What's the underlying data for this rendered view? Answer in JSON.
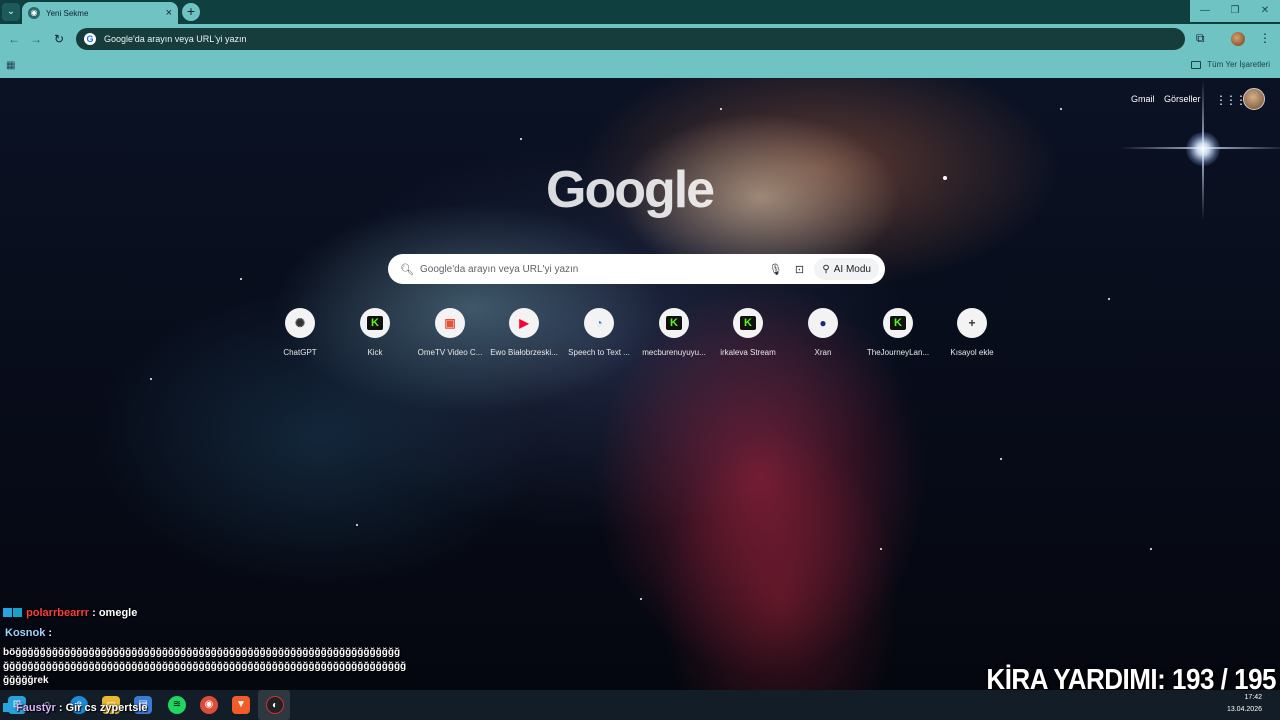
{
  "browser": {
    "tab_title": "Yeni Sekme",
    "omnibox_text": "Google'da arayın veya URL'yi yazın",
    "all_bookmarks": "Tüm Yer İşaretleri"
  },
  "ntp": {
    "gmail": "Gmail",
    "images": "Görseller",
    "logo": "Google",
    "search_placeholder": "Google'da arayın veya URL'yi yazın",
    "ai_mode": "AI Modu",
    "shortcuts": [
      {
        "label": "ChatGPT",
        "icon": "chatgpt-icon",
        "glyph": "✺",
        "color": "#333333"
      },
      {
        "label": "Kick",
        "icon": "kick-icon",
        "glyph": "K",
        "color": "#53fc18"
      },
      {
        "label": "OmeTV Video C...",
        "icon": "ometv-icon",
        "glyph": "▣",
        "color": "#e5533d"
      },
      {
        "label": "Ewo Białobrzeski...",
        "icon": "youtube-icon",
        "glyph": "▶",
        "color": "#ff0033"
      },
      {
        "label": "Speech to Text ...",
        "icon": "speech-icon",
        "glyph": "◔",
        "color": "#4a7bd0"
      },
      {
        "label": "mecburenuyuyu...",
        "icon": "kick-icon",
        "glyph": "K",
        "color": "#53fc18"
      },
      {
        "label": "irkaleva Stream",
        "icon": "kick-icon",
        "glyph": "K",
        "color": "#53fc18"
      },
      {
        "label": "Xran",
        "icon": "xran-icon",
        "glyph": "●",
        "color": "#1b2a7a"
      },
      {
        "label": "TheJourneyLan...",
        "icon": "kick-icon",
        "glyph": "K",
        "color": "#53fc18"
      },
      {
        "label": "Kısayol ekle",
        "icon": "plus-icon",
        "glyph": "+",
        "color": "#333333"
      }
    ]
  },
  "chat": {
    "msg1_user": "polarrbearrr",
    "msg1_text": " : omegle",
    "msg2_user": "Kosnok",
    "msg2_sep": " :",
    "msg2_line1": "böğğğğğğğğğğğğğğğğğğğğğğğğğğğğğğğğğğğğğğğğğğğğğğğğğğğğğğğğğğğğğğğ",
    "msg2_line2": "ğğğğğğğğğğğğğğğğğğğğğğğğğğğğğğğğğğğğğğğğğğğğğğğğğğğğğğğğğğğğğğğğğğ",
    "msg2_line3": "ğğğğğrek",
    "msg3_user": "Faustyr",
    "msg3_text": " : Gir cs zypertsle"
  },
  "overlay": {
    "kira_label": "KİRA YARDIMI:",
    "kira_current": "193",
    "kira_sep": " / ",
    "kira_total": "195"
  },
  "taskbar": {
    "time": "17:42",
    "date": "13.04.2026"
  }
}
